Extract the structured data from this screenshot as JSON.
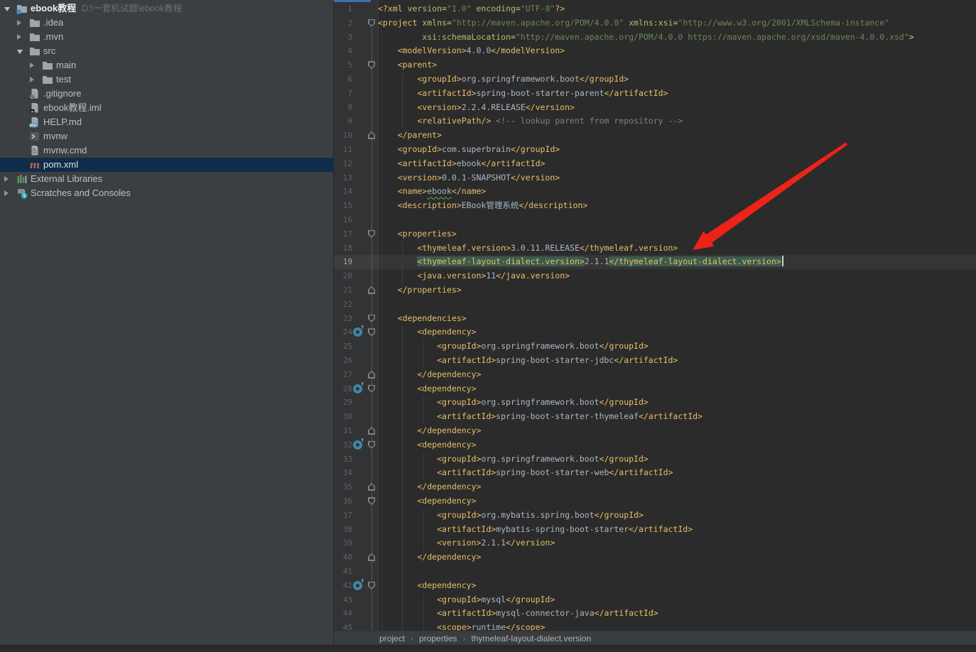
{
  "colors": {
    "editor_bg": "#2B2B2B",
    "panel_bg": "#3C3F41",
    "gutter_bg": "#313335",
    "selection_bg": "#0E2D4A",
    "tag": "#E8BF6A",
    "attr": "#BABC6A",
    "string_value": "#6A8759",
    "body_text": "#A9B7C6",
    "comment": "#808080",
    "matched_tag_bg": "#3C5B4C",
    "tab_accent": "#3F6FB5",
    "arrow_red": "#ED2318"
  },
  "project_tree": {
    "items": [
      {
        "depth": 0,
        "arrow": "down",
        "icon": "project-folder",
        "label": "ebook教程",
        "bold": true,
        "path": "D:\\一套机试题\\ebook教程"
      },
      {
        "depth": 1,
        "arrow": "right",
        "icon": "folder",
        "label": ".idea"
      },
      {
        "depth": 1,
        "arrow": "right",
        "icon": "folder",
        "label": ".mvn"
      },
      {
        "depth": 1,
        "arrow": "down",
        "icon": "folder",
        "label": "src"
      },
      {
        "depth": 2,
        "arrow": "right",
        "icon": "folder",
        "label": "main"
      },
      {
        "depth": 2,
        "arrow": "right",
        "icon": "folder",
        "label": "test"
      },
      {
        "depth": 1,
        "icon": "gitignore-file",
        "label": ".gitignore"
      },
      {
        "depth": 1,
        "icon": "iml-file",
        "label": "ebook教程.iml"
      },
      {
        "depth": 1,
        "icon": "md-file",
        "label": "HELP.md"
      },
      {
        "depth": 1,
        "icon": "shell-file",
        "label": "mvnw"
      },
      {
        "depth": 1,
        "icon": "cmd-file",
        "label": "mvnw.cmd"
      },
      {
        "depth": 1,
        "icon": "maven-file",
        "label": "pom.xml",
        "selected": true
      },
      {
        "depth": 0,
        "arrow": "right",
        "icon": "libraries",
        "label": "External Libraries"
      },
      {
        "depth": 0,
        "arrow": "right",
        "icon": "scratches",
        "label": "Scratches and Consoles"
      }
    ]
  },
  "editor": {
    "caret_line": 19,
    "maven_icon_lines": [
      24,
      28,
      32,
      42
    ],
    "fold_start_lines": [
      2,
      5,
      17,
      23,
      24,
      28,
      32,
      36,
      42
    ],
    "fold_end_lines": [
      10,
      21,
      27,
      31,
      35,
      40
    ],
    "lines": [
      {
        "n": 1,
        "segs": [
          [
            "tag",
            "<?xml "
          ],
          [
            "attr",
            "version"
          ],
          [
            "tag",
            "="
          ],
          [
            "val",
            "\"1.0\""
          ],
          [
            "attr",
            " encoding"
          ],
          [
            "tag",
            "="
          ],
          [
            "val",
            "\"UTF-8\""
          ],
          [
            "tag",
            "?>"
          ]
        ]
      },
      {
        "n": 2,
        "segs": [
          [
            "tag",
            "<project "
          ],
          [
            "attr",
            "xmlns"
          ],
          [
            "tag",
            "="
          ],
          [
            "val",
            "\"http://maven.apache.org/POM/4.0.0\""
          ],
          [
            "attr",
            " xmlns:xsi"
          ],
          [
            "tag",
            "="
          ],
          [
            "val",
            "\"http://www.w3.org/2001/XMLSchema-instance\""
          ]
        ]
      },
      {
        "n": 3,
        "segs": [
          [
            "attr",
            "         xsi:schemaLocation"
          ],
          [
            "tag",
            "="
          ],
          [
            "val",
            "\"http://maven.apache.org/POM/4.0.0 https://maven.apache.org/xsd/maven-4.0.0.xsd\""
          ],
          [
            "tag",
            ">"
          ]
        ]
      },
      {
        "n": 4,
        "segs": [
          [
            "tag",
            "    <modelVersion>"
          ],
          [
            "txt",
            "4.0.0"
          ],
          [
            "tag",
            "</modelVersion>"
          ]
        ]
      },
      {
        "n": 5,
        "segs": [
          [
            "tag",
            "    <parent>"
          ]
        ]
      },
      {
        "n": 6,
        "segs": [
          [
            "tag",
            "        <groupId>"
          ],
          [
            "txt",
            "org.springframework.boot"
          ],
          [
            "tag",
            "</groupId>"
          ]
        ]
      },
      {
        "n": 7,
        "segs": [
          [
            "tag",
            "        <artifactId>"
          ],
          [
            "txt",
            "spring-boot-starter-parent"
          ],
          [
            "tag",
            "</artifactId>"
          ]
        ]
      },
      {
        "n": 8,
        "segs": [
          [
            "tag",
            "        <version>"
          ],
          [
            "txt",
            "2.2.4.RELEASE"
          ],
          [
            "tag",
            "</version>"
          ]
        ]
      },
      {
        "n": 9,
        "segs": [
          [
            "tag",
            "        <relativePath/>"
          ],
          [
            "cmt",
            " <!-- lookup parent from repository -->"
          ]
        ]
      },
      {
        "n": 10,
        "segs": [
          [
            "tag",
            "    </parent>"
          ]
        ]
      },
      {
        "n": 11,
        "segs": [
          [
            "tag",
            "    <groupId>"
          ],
          [
            "txt",
            "com.superbrain"
          ],
          [
            "tag",
            "</groupId>"
          ]
        ]
      },
      {
        "n": 12,
        "segs": [
          [
            "tag",
            "    <artifactId>"
          ],
          [
            "txt",
            "ebook"
          ],
          [
            "tag",
            "</artifactId>"
          ]
        ]
      },
      {
        "n": 13,
        "segs": [
          [
            "tag",
            "    <version>"
          ],
          [
            "txt",
            "0.0.1-SNAPSHOT"
          ],
          [
            "tag",
            "</version>"
          ]
        ]
      },
      {
        "n": 14,
        "segs": [
          [
            "tag",
            "    <name>"
          ],
          [
            "typo",
            "ebook"
          ],
          [
            "tag",
            "</name>"
          ]
        ]
      },
      {
        "n": 15,
        "segs": [
          [
            "tag",
            "    <description>"
          ],
          [
            "txt",
            "EBook管理系统"
          ],
          [
            "tag",
            "</description>"
          ]
        ]
      },
      {
        "n": 16,
        "segs": []
      },
      {
        "n": 17,
        "segs": [
          [
            "tag",
            "    <properties>"
          ]
        ]
      },
      {
        "n": 18,
        "segs": [
          [
            "tag",
            "        <thymeleaf.version>"
          ],
          [
            "txt",
            "3.0.11.RELEASE"
          ],
          [
            "tag",
            "</thymeleaf.version>"
          ]
        ]
      },
      {
        "n": 19,
        "segs": [
          [
            "txt",
            "        "
          ],
          [
            "hl",
            "<thymeleaf-layout-dialect.version>"
          ],
          [
            "txt",
            "2.1.1"
          ],
          [
            "hl",
            "</thymeleaf-layout-dialect.version>"
          ],
          [
            "caret",
            ""
          ]
        ]
      },
      {
        "n": 20,
        "segs": [
          [
            "tag",
            "        <java.version>"
          ],
          [
            "txt",
            "11"
          ],
          [
            "tag",
            "</java.version>"
          ]
        ]
      },
      {
        "n": 21,
        "segs": [
          [
            "tag",
            "    </properties>"
          ]
        ]
      },
      {
        "n": 22,
        "segs": []
      },
      {
        "n": 23,
        "segs": [
          [
            "tag",
            "    <dependencies>"
          ]
        ]
      },
      {
        "n": 24,
        "segs": [
          [
            "tag",
            "        <dependency>"
          ]
        ]
      },
      {
        "n": 25,
        "segs": [
          [
            "tag",
            "            <groupId>"
          ],
          [
            "txt",
            "org.springframework.boot"
          ],
          [
            "tag",
            "</groupId>"
          ]
        ]
      },
      {
        "n": 26,
        "segs": [
          [
            "tag",
            "            <artifactId>"
          ],
          [
            "txt",
            "spring-boot-starter-jdbc"
          ],
          [
            "tag",
            "</artifactId>"
          ]
        ]
      },
      {
        "n": 27,
        "segs": [
          [
            "tag",
            "        </dependency>"
          ]
        ]
      },
      {
        "n": 28,
        "segs": [
          [
            "tag",
            "        <dependency>"
          ]
        ]
      },
      {
        "n": 29,
        "segs": [
          [
            "tag",
            "            <groupId>"
          ],
          [
            "txt",
            "org.springframework.boot"
          ],
          [
            "tag",
            "</groupId>"
          ]
        ]
      },
      {
        "n": 30,
        "segs": [
          [
            "tag",
            "            <artifactId>"
          ],
          [
            "txt",
            "spring-boot-starter-thymeleaf"
          ],
          [
            "tag",
            "</artifactId>"
          ]
        ]
      },
      {
        "n": 31,
        "segs": [
          [
            "tag",
            "        </dependency>"
          ]
        ]
      },
      {
        "n": 32,
        "segs": [
          [
            "tag",
            "        <dependency>"
          ]
        ]
      },
      {
        "n": 33,
        "segs": [
          [
            "tag",
            "            <groupId>"
          ],
          [
            "txt",
            "org.springframework.boot"
          ],
          [
            "tag",
            "</groupId>"
          ]
        ]
      },
      {
        "n": 34,
        "segs": [
          [
            "tag",
            "            <artifactId>"
          ],
          [
            "txt",
            "spring-boot-starter-web"
          ],
          [
            "tag",
            "</artifactId>"
          ]
        ]
      },
      {
        "n": 35,
        "segs": [
          [
            "tag",
            "        </dependency>"
          ]
        ]
      },
      {
        "n": 36,
        "segs": [
          [
            "tag",
            "        <dependency>"
          ]
        ]
      },
      {
        "n": 37,
        "segs": [
          [
            "tag",
            "            <groupId>"
          ],
          [
            "txt",
            "org.mybatis.spring.boot"
          ],
          [
            "tag",
            "</groupId>"
          ]
        ]
      },
      {
        "n": 38,
        "segs": [
          [
            "tag",
            "            <artifactId>"
          ],
          [
            "txt",
            "mybatis-spring-boot-starter"
          ],
          [
            "tag",
            "</artifactId>"
          ]
        ]
      },
      {
        "n": 39,
        "segs": [
          [
            "tag",
            "            <version>"
          ],
          [
            "txt",
            "2.1.1"
          ],
          [
            "tag",
            "</version>"
          ]
        ]
      },
      {
        "n": 40,
        "segs": [
          [
            "tag",
            "        </dependency>"
          ]
        ]
      },
      {
        "n": 41,
        "segs": []
      },
      {
        "n": 42,
        "segs": [
          [
            "tag",
            "        <dependency>"
          ]
        ]
      },
      {
        "n": 43,
        "segs": [
          [
            "tag",
            "            <groupId>"
          ],
          [
            "txt",
            "mysql"
          ],
          [
            "tag",
            "</groupId>"
          ]
        ]
      },
      {
        "n": 44,
        "segs": [
          [
            "tag",
            "            <artifactId>"
          ],
          [
            "txt",
            "mysql-connector-java"
          ],
          [
            "tag",
            "</artifactId>"
          ]
        ]
      },
      {
        "n": 45,
        "segs": [
          [
            "tag",
            "            <scope>"
          ],
          [
            "txt",
            "runtime"
          ],
          [
            "tag",
            "</scope>"
          ]
        ]
      }
    ]
  },
  "breadcrumbs": {
    "separator": "›",
    "items": [
      "project",
      "properties",
      "thymeleaf-layout-dialect.version"
    ]
  },
  "annotation_arrow": {
    "shape": "arrow",
    "color": "#ED2318"
  }
}
